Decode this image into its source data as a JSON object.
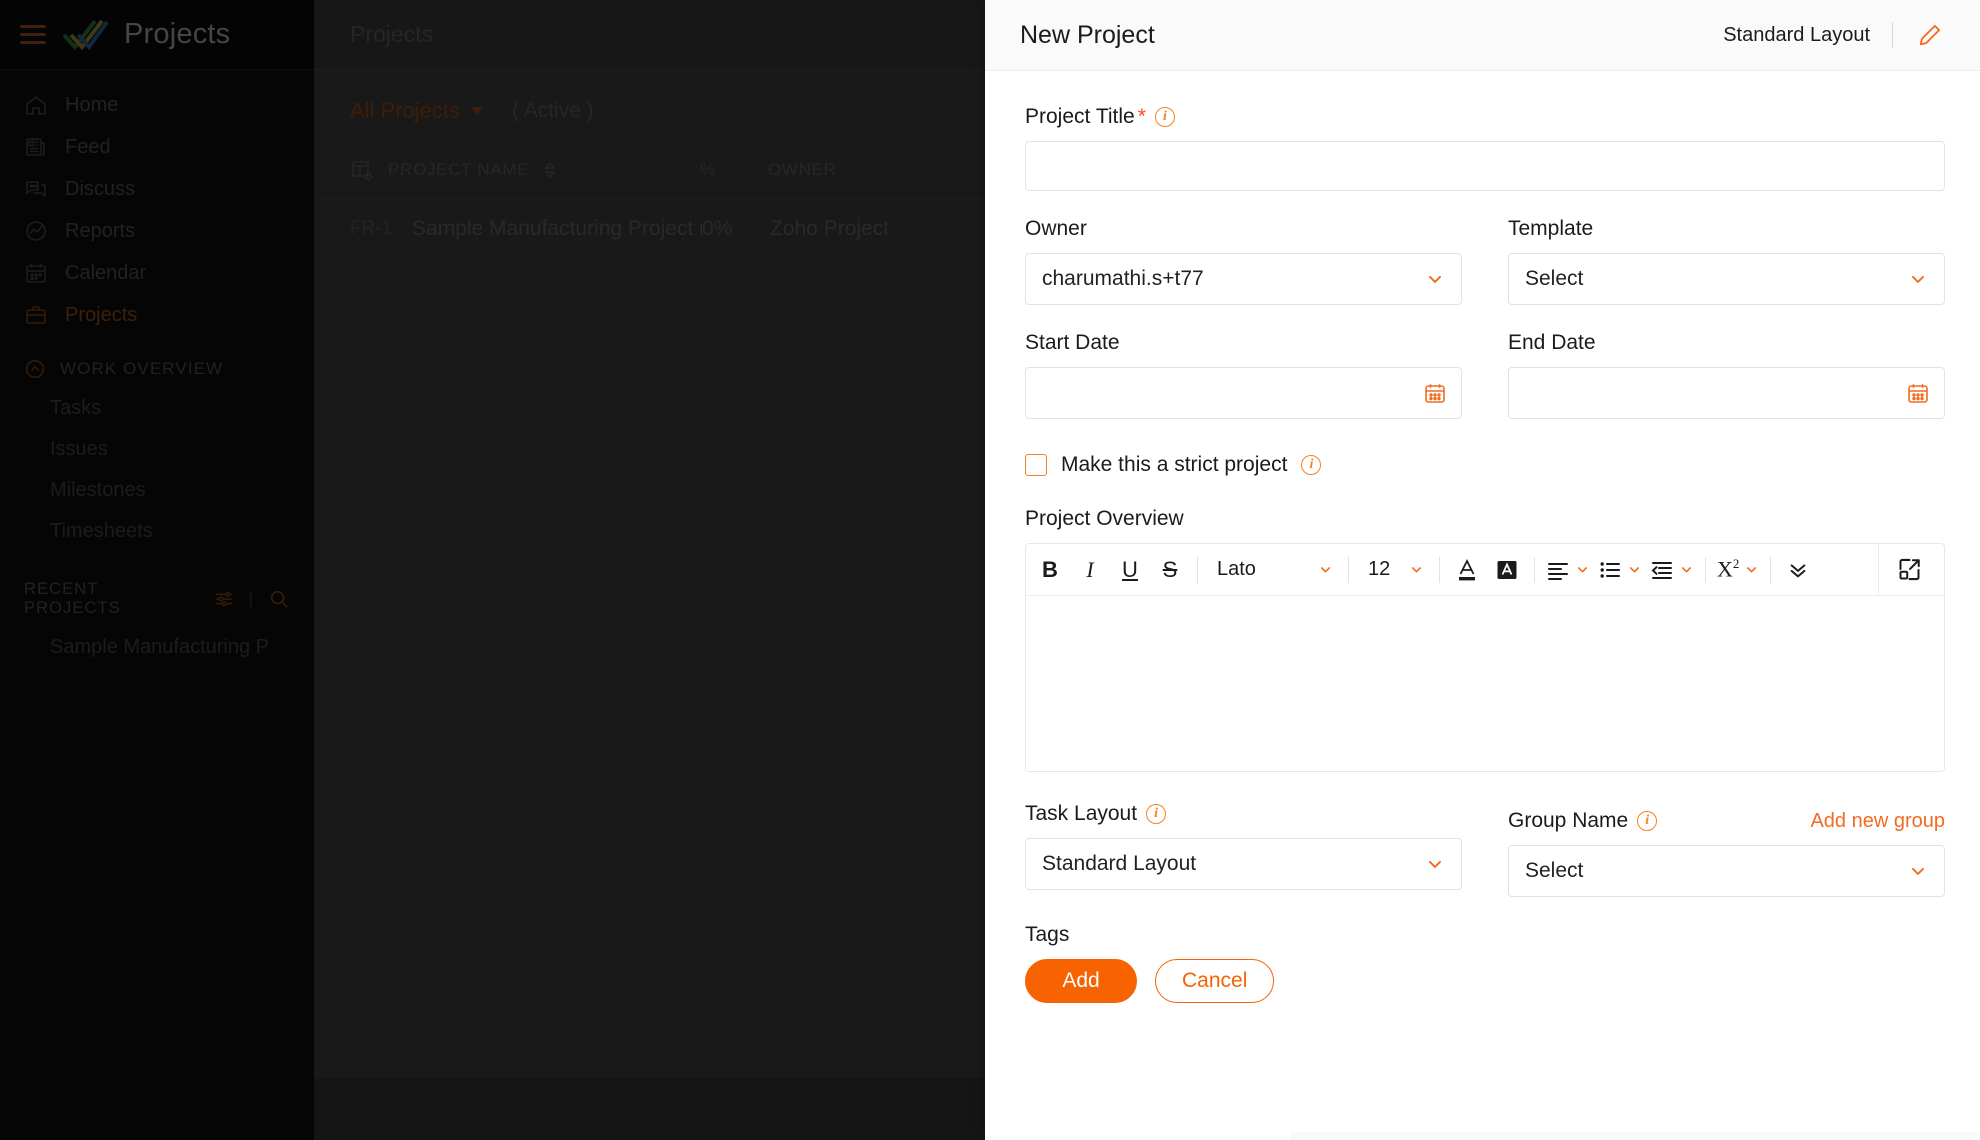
{
  "background": {
    "sidebar": {
      "hamburger_icon": "hamburger-menu-icon",
      "logo_icon": "zoho-projects-checkmark-logo",
      "app_title": "Projects",
      "nav": [
        {
          "label": "Home",
          "icon": "home-icon",
          "active": false
        },
        {
          "label": "Feed",
          "icon": "feed-icon",
          "active": false
        },
        {
          "label": "Discuss",
          "icon": "discuss-chat-icon",
          "active": false
        },
        {
          "label": "Reports",
          "icon": "reports-chart-icon",
          "active": false
        },
        {
          "label": "Calendar",
          "icon": "calendar-icon",
          "active": false
        },
        {
          "label": "Projects",
          "icon": "briefcase-icon",
          "active": true
        }
      ],
      "work_overview": {
        "label": "WORK OVERVIEW",
        "collapse_icon": "chevron-up-circle-icon",
        "items": [
          "Tasks",
          "Issues",
          "Milestones",
          "Timesheets"
        ]
      },
      "recent_projects": {
        "label": "RECENT PROJECTS",
        "filter_icon": "sliders-filter-icon",
        "separator": "|",
        "search_icon": "search-icon",
        "items": [
          "Sample Manufacturing P"
        ]
      }
    },
    "main": {
      "header_title": "Projects",
      "filter_label": "All Projects",
      "filter_caret_icon": "caret-down-icon",
      "status_label": "( Active )",
      "table": {
        "column_settings_icon": "table-column-settings-icon",
        "headers": [
          "PROJECT NAME",
          "%",
          "OWNER"
        ],
        "sort_icon": "sort-updown-icon",
        "rows": [
          {
            "code": "FR-1",
            "name": "Sample Manufacturing Project (Au",
            "percent": "0%",
            "owner": "Zoho Project"
          }
        ]
      }
    }
  },
  "panel": {
    "title": "New Project",
    "layout_name": "Standard Layout",
    "edit_icon": "pencil-edit-icon",
    "fields": {
      "project_title": {
        "label": "Project Title",
        "required_marker": "*",
        "info_icon": "info-circle-icon",
        "value": "",
        "placeholder": ""
      },
      "owner": {
        "label": "Owner",
        "value": "charumathi.s+t77",
        "chevron_icon": "chevron-down-icon"
      },
      "template": {
        "label": "Template",
        "value": "Select",
        "chevron_icon": "chevron-down-icon"
      },
      "start_date": {
        "label": "Start Date",
        "value": "",
        "calendar_icon": "calendar-icon"
      },
      "end_date": {
        "label": "End Date",
        "value": "",
        "calendar_icon": "calendar-icon"
      },
      "strict_project": {
        "label": "Make this a strict project",
        "checked": false,
        "info_icon": "info-circle-icon"
      },
      "project_overview": {
        "label": "Project Overview",
        "value": ""
      },
      "task_layout": {
        "label": "Task Layout",
        "info_icon": "info-circle-icon",
        "value": "Standard Layout",
        "chevron_icon": "chevron-down-icon"
      },
      "group_name": {
        "label": "Group Name",
        "info_icon": "info-circle-icon",
        "add_new_label": "Add new group",
        "value": "Select",
        "chevron_icon": "chevron-down-icon"
      },
      "tags": {
        "label": "Tags"
      }
    },
    "editor_toolbar": {
      "bold": "B",
      "italic": "I",
      "underline": "U",
      "strikethrough": "S",
      "font_family": "Lato",
      "font_size": "12",
      "font_color_icon": "font-color-A-icon",
      "highlight_icon": "highlight-background-A-icon",
      "align_icon": "align-left-icon",
      "list_icon": "bulleted-list-icon",
      "indent_icon": "indent-decrease-icon",
      "superscript_icon": "superscript-x2-icon",
      "more_icon": "chevron-double-down-icon",
      "expand_icon": "expand-fullscreen-icon",
      "caret_icon": "chevron-down-icon"
    },
    "actions": {
      "add_label": "Add",
      "cancel_label": "Cancel"
    }
  },
  "colors": {
    "accent_orange": "#f26b21",
    "primary_button": "#f66300",
    "link_orange": "#f26b21",
    "required_red": "#ff4b1f",
    "sidebar_bg": "#0d0d0d",
    "panel_bg": "#ffffff"
  }
}
